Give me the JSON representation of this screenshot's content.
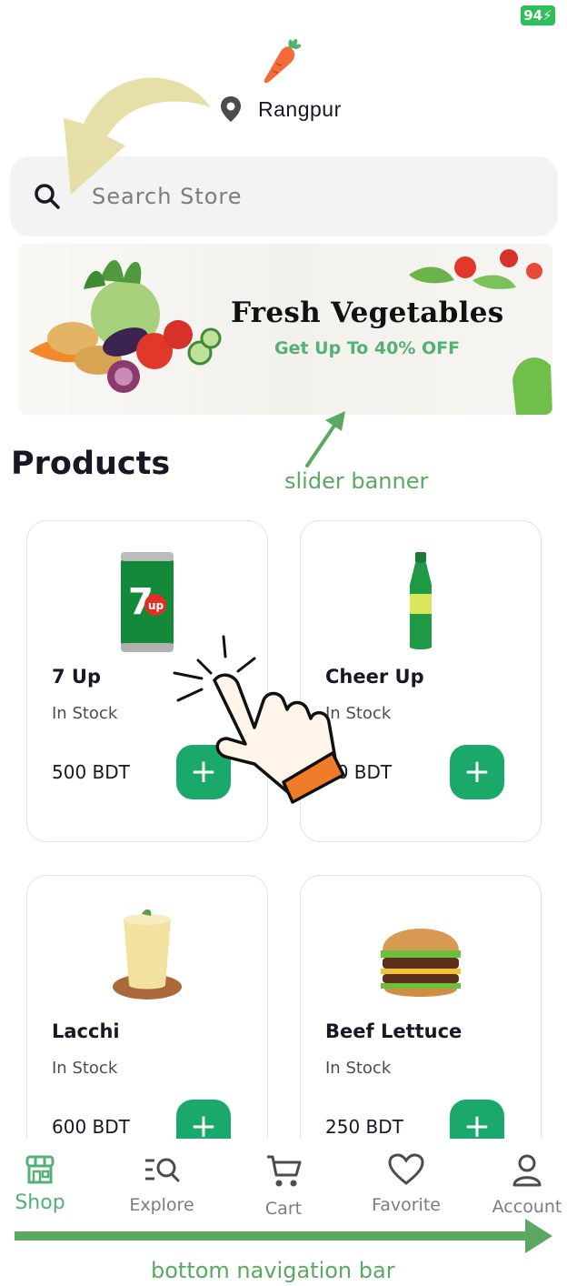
{
  "status_bar": {
    "battery": "94"
  },
  "header": {
    "location": "Rangpur"
  },
  "search": {
    "placeholder": "Search Store"
  },
  "banner": {
    "title": "Fresh Vegetables",
    "subtitle": "Get Up To 40% OFF"
  },
  "products_section": {
    "title": "Products"
  },
  "products": [
    {
      "name": "7 Up",
      "stock": "In Stock",
      "price": "500 BDT",
      "add_label": "+"
    },
    {
      "name": "Cheer Up",
      "stock": "In Stock",
      "price": "50 BDT",
      "add_label": "+"
    },
    {
      "name": "Lacchi",
      "stock": "In Stock",
      "price": "600 BDT",
      "add_label": "+"
    },
    {
      "name": "Beef Lettuce",
      "stock": "In Stock",
      "price": "250 BDT",
      "add_label": "+"
    }
  ],
  "bottom_nav": {
    "items": [
      {
        "label": "Shop",
        "icon": "store-icon",
        "active": true
      },
      {
        "label": "Explore",
        "icon": "explore-search-icon",
        "active": false
      },
      {
        "label": "Cart",
        "icon": "cart-icon",
        "active": false
      },
      {
        "label": "Favorite",
        "icon": "heart-icon",
        "active": false
      },
      {
        "label": "Account",
        "icon": "user-icon",
        "active": false
      }
    ]
  },
  "annotations": {
    "banner_note": "slider banner",
    "nav_note": "bottom navigation bar"
  },
  "colors": {
    "accent_green": "#53b175",
    "button_green": "#1aa96a",
    "battery_green": "#2fbf5a",
    "annotation_green": "#5ba862",
    "arrow_yellow": "#e3dc9e"
  }
}
